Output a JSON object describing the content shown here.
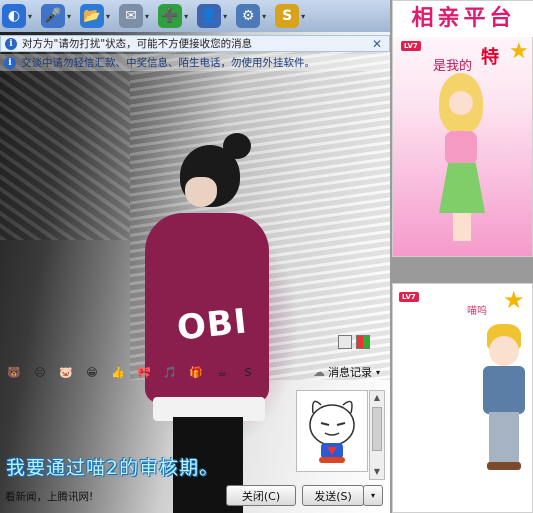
{
  "toolbar": {
    "buttons": [
      {
        "name": "qq-show-icon",
        "glyph": "◐",
        "color": "#2b6fd6"
      },
      {
        "name": "microphone-icon",
        "glyph": "🎤",
        "color": "#3f74c9"
      },
      {
        "name": "file-transfer-icon",
        "glyph": "📂",
        "color": "#2d7bd6"
      },
      {
        "name": "message-icon",
        "glyph": "✉",
        "color": "#7c8fa6"
      },
      {
        "name": "remote-icon",
        "glyph": "➕",
        "color": "#2f9f3f"
      },
      {
        "name": "user-info-icon",
        "glyph": "👤",
        "color": "#3c66b1"
      },
      {
        "name": "settings-icon",
        "glyph": "⚙",
        "color": "#4c79b8"
      },
      {
        "name": "soso-icon",
        "glyph": "S",
        "color": "#d9a21c"
      }
    ],
    "dropdown_glyph": "▾"
  },
  "notices": {
    "first": "对方为\"请勿打扰\"状态，可能不方便接收您的消息",
    "second": "交谈中请勿轻信汇款、中奖信息、陌生电话，勿使用外挂软件。",
    "info_glyph": "i",
    "close_glyph": "✕"
  },
  "emoji_bar": {
    "items": [
      "🐻",
      "😐",
      "🐷",
      "😁",
      "👍",
      "🎀",
      "🎵",
      "🎁",
      "☕",
      "S"
    ],
    "history_label": "消息记录",
    "dropdown_glyph": "▾"
  },
  "input": {
    "text": "我要通过喵2的审核期。"
  },
  "scroll": {
    "up_glyph": "▲",
    "down_glyph": "▼"
  },
  "bottom": {
    "news": "看新闻，上腾讯网!",
    "close_label": "关闭(C)",
    "send_label": "发送(S)",
    "send_drop_glyph": "▾"
  },
  "side": {
    "top_ad": {
      "title": "相亲平台",
      "badge": "LV7",
      "line": "是我的",
      "special": "特",
      "star_glyph": "★"
    },
    "bottom_ad": {
      "badge": "LV7",
      "name": "喵呜",
      "star_glyph": "★"
    }
  },
  "colors": {
    "toolbar_top": "#c8d9ee",
    "toolbar_bottom": "#9fb6d2",
    "hoodie": "#8a1f4e",
    "ad_title": "#e11a70",
    "input_text": "#bdf3ff"
  }
}
